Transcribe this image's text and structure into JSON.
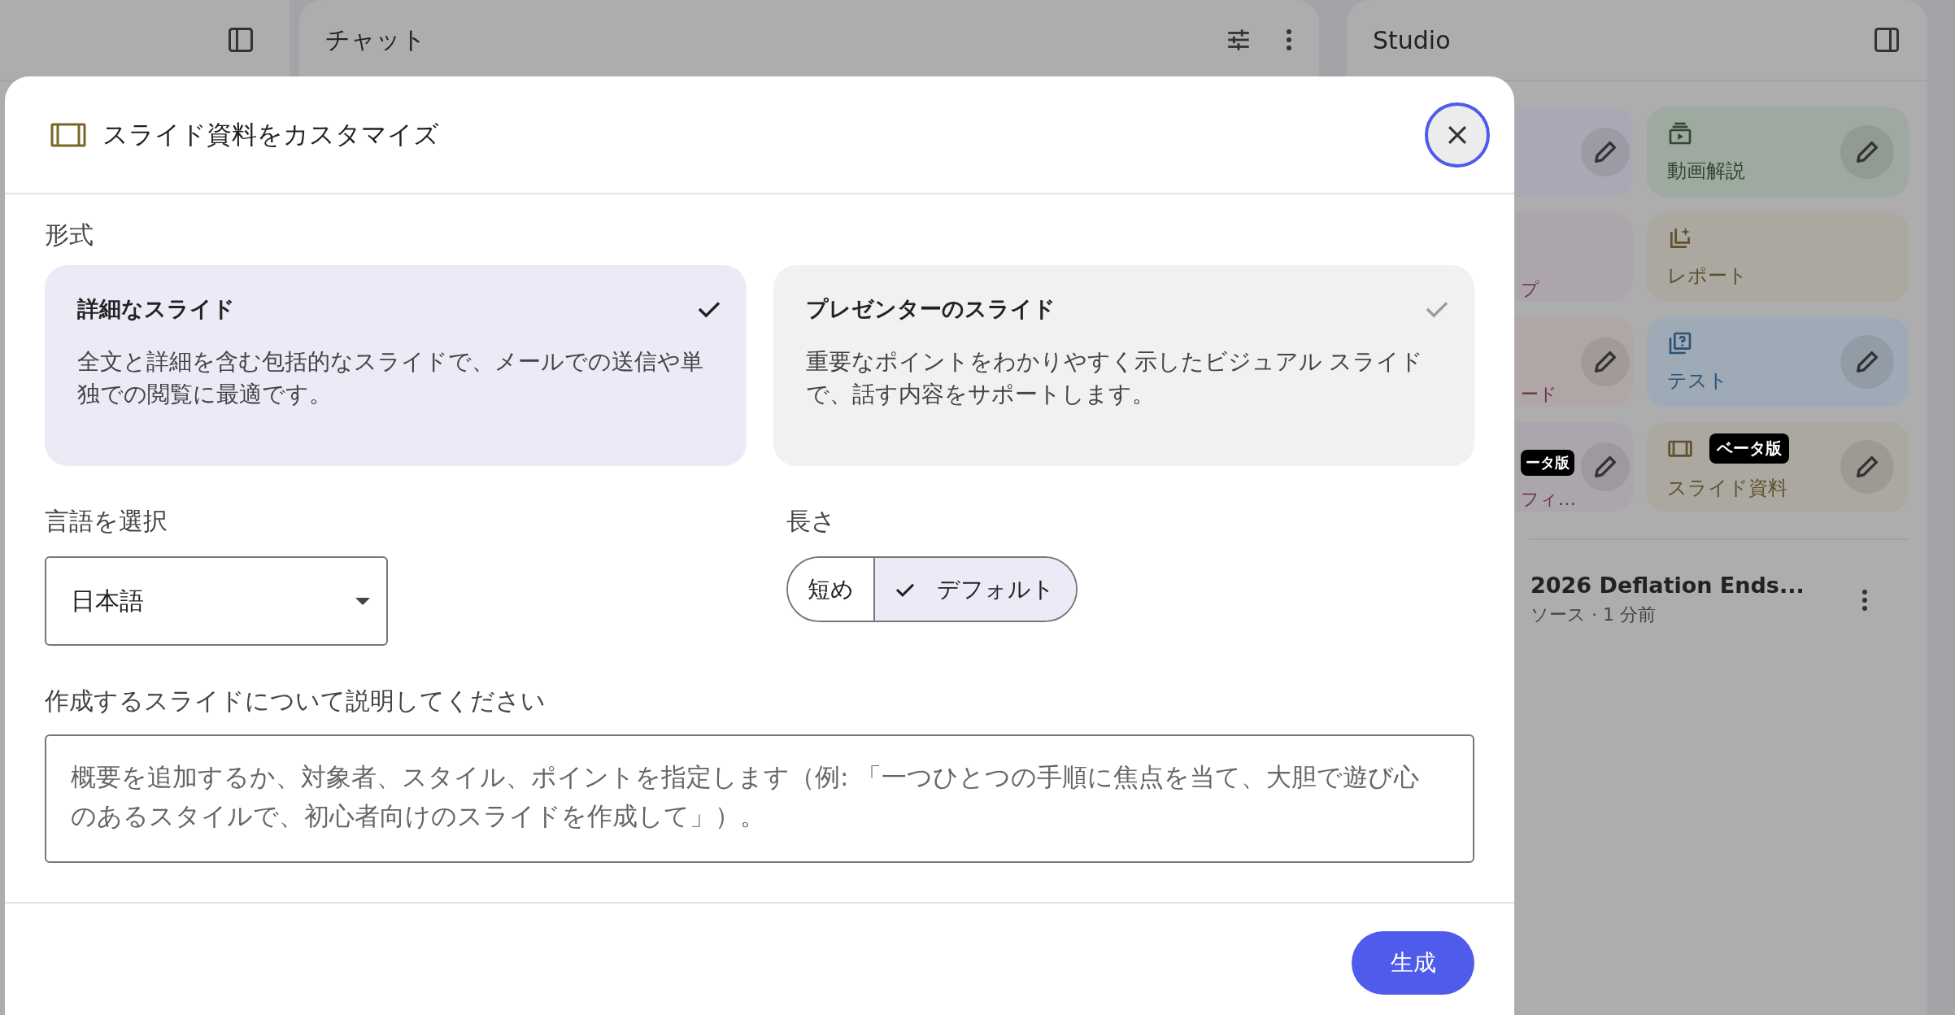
{
  "chat_panel": {
    "title": "チャット"
  },
  "studio_panel": {
    "title": "Studio",
    "tiles": [
      {
        "kind": "hidden",
        "edit": true,
        "color": "#a9a9b5"
      },
      {
        "label": "動画解説",
        "kind": "video",
        "edit": true,
        "color": "#9ea99f"
      },
      {
        "label": "プ",
        "kind": "hidden",
        "edit": false,
        "color": "#aca6ac"
      },
      {
        "label": "レポート",
        "kind": "report",
        "edit": false,
        "color": "#aaa89f"
      },
      {
        "label": "ード",
        "kind": "hidden",
        "edit": true,
        "color": "#b0a6a6"
      },
      {
        "label": "テスト",
        "kind": "quiz",
        "edit": true,
        "color": "#9eaab6"
      },
      {
        "label": "フィ…",
        "kind": "hidden",
        "badge": "ータ版",
        "edit": true,
        "color": "#aba6ad"
      },
      {
        "label": "スライド資料",
        "kind": "slides",
        "badge": "ベータ版",
        "edit": true,
        "color": "#aaa89f"
      }
    ],
    "note": {
      "title": "2026 Deflation Ends...",
      "meta": "ソース · 1 分前"
    }
  },
  "dialog": {
    "title": "スライド資料をカスタマイズ",
    "format": {
      "label": "形式",
      "options": [
        {
          "title": "詳細なスライド",
          "description": "全文と詳細を含む包括的なスライドで、メールでの送信や単独での閲覧に最適です。",
          "selected": true
        },
        {
          "title": "プレゼンターのスライド",
          "description": "重要なポイントをわかりやすく示したビジュアル スライドで、話す内容をサポートします。",
          "selected": false
        }
      ]
    },
    "language": {
      "label": "言語を選択",
      "value": "日本語"
    },
    "length": {
      "label": "長さ",
      "options": [
        {
          "label": "短め",
          "selected": false
        },
        {
          "label": "デフォルト",
          "selected": true
        }
      ]
    },
    "description": {
      "label": "作成するスライドについて説明してください",
      "placeholder": "概要を追加するか、対象者、スタイル、ポイントを指定します（例: 「一つひとつの手順に焦点を当て、大胆で遊び心のあるスタイルで、初心者向けのスライドを作成して」）。"
    },
    "generate_button": "生成"
  }
}
